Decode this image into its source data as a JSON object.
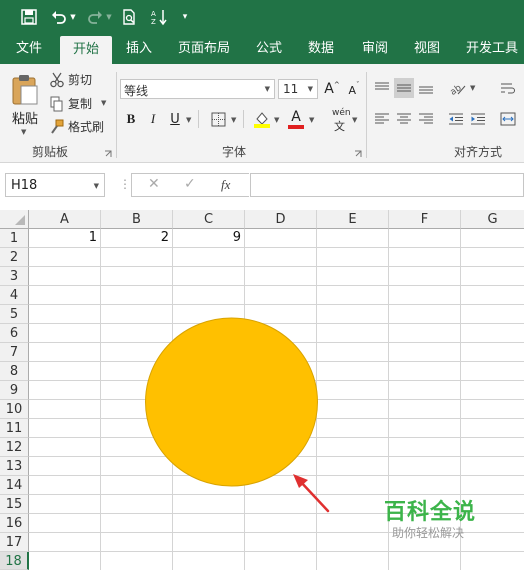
{
  "qat": {
    "icons": [
      "save-icon",
      "undo-icon",
      "redo-icon",
      "print-preview-icon",
      "sort-icon",
      "customize-qat-icon"
    ]
  },
  "tabs": [
    {
      "label": "文件"
    },
    {
      "label": "开始"
    },
    {
      "label": "插入"
    },
    {
      "label": "页面布局"
    },
    {
      "label": "公式"
    },
    {
      "label": "数据"
    },
    {
      "label": "审阅"
    },
    {
      "label": "视图"
    },
    {
      "label": "开发工具"
    }
  ],
  "active_tab": "开始",
  "ribbon": {
    "clipboard": {
      "paste_label": "粘贴",
      "cut_label": "剪切",
      "copy_label": "复制",
      "format_painter_label": "格式刷",
      "group_title": "剪贴板"
    },
    "font": {
      "font_name": "等线",
      "font_size": "11",
      "grow_label": "A",
      "shrink_label": "A",
      "bold_label": "B",
      "italic_label": "I",
      "underline_label": "U",
      "font_color_label": "A",
      "phonetic_top": "wén",
      "phonetic_bottom": "文",
      "group_title": "字体"
    },
    "alignment": {
      "group_title": "对齐方式"
    }
  },
  "formula_bar": {
    "name_box": "H18",
    "cancel_symbol": "✕",
    "enter_symbol": "✓",
    "fx_label": "fx",
    "formula_value": ""
  },
  "sheet": {
    "columns": [
      "A",
      "B",
      "C",
      "D",
      "E",
      "F",
      "G"
    ],
    "rows": [
      "1",
      "2",
      "3",
      "4",
      "5",
      "6",
      "7",
      "8",
      "9",
      "10",
      "11",
      "12",
      "13",
      "14",
      "15",
      "16",
      "17",
      "18"
    ],
    "selected_row": "18",
    "cells": {
      "A1": "1",
      "B1": "2",
      "C1": "9"
    }
  },
  "shape": {
    "type": "circle",
    "fill": "#FFC000",
    "stroke": "#D9A300"
  },
  "annotation_arrow_color": "#E03030",
  "watermark": {
    "title": "百科全说",
    "subtitle": "助你轻松解决",
    "title_color": "#3CB44A"
  },
  "colors": {
    "excel_green": "#217346",
    "ribbon_bg": "#F3F3F3"
  }
}
